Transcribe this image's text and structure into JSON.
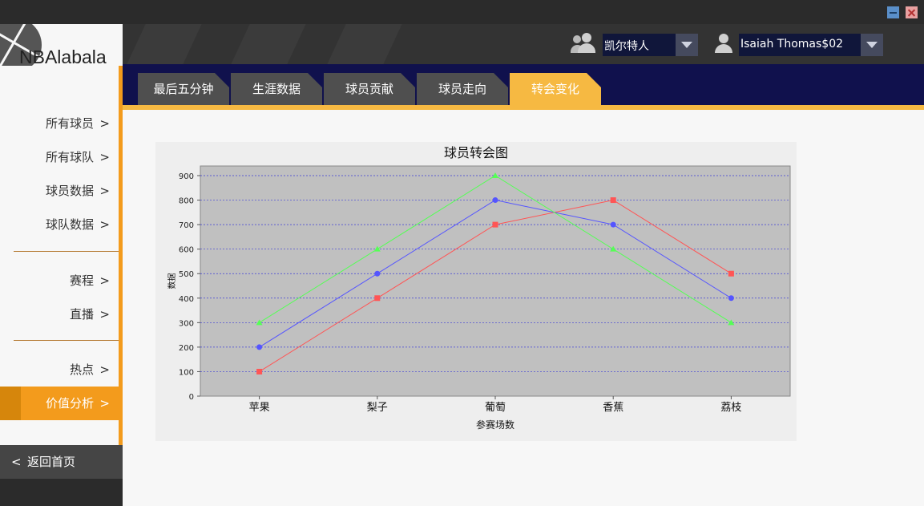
{
  "app": {
    "name": "NBAlabala"
  },
  "window": {
    "minimize_icon": "minimize-icon",
    "close_icon": "close-icon"
  },
  "header": {
    "team_select": {
      "value": "凯尔特人",
      "icon": "group-users-icon"
    },
    "player_select": {
      "value": "Isaiah Thomas$02",
      "icon": "user-icon"
    }
  },
  "tabs": [
    {
      "label": "最后五分钟",
      "active": false
    },
    {
      "label": "生涯数据",
      "active": false
    },
    {
      "label": "球员贡献",
      "active": false
    },
    {
      "label": "球员走向",
      "active": false
    },
    {
      "label": "转会变化",
      "active": true
    }
  ],
  "sidebar": {
    "items": [
      {
        "label": "所有球员",
        "chevron": ">"
      },
      {
        "label": "所有球队",
        "chevron": ">"
      },
      {
        "label": "球员数据",
        "chevron": ">"
      },
      {
        "label": "球队数据",
        "chevron": ">"
      },
      {
        "label": "赛程",
        "chevron": ">"
      },
      {
        "label": "直播",
        "chevron": ">"
      },
      {
        "label": "热点",
        "chevron": ">"
      },
      {
        "label": "价值分析",
        "chevron": ">",
        "active": true
      }
    ],
    "back": {
      "chevron": "<",
      "label": "返回首页"
    }
  },
  "colors": {
    "accent": "#f39b1c",
    "tab_active": "#f6b942",
    "tab_inactive": "#4f4f4f",
    "tabbar_bg": "#10114d",
    "plot_bg": "#c0c0c0"
  },
  "chart_data": {
    "type": "line",
    "title": "球员转会图",
    "xlabel": "参赛场数",
    "ylabel": "数据",
    "categories": [
      "苹果",
      "梨子",
      "葡萄",
      "香蕉",
      "荔枝"
    ],
    "ylim": [
      0,
      900
    ],
    "yticks": [
      0,
      100,
      200,
      300,
      400,
      500,
      600,
      700,
      800,
      900
    ],
    "grid": true,
    "series": [
      {
        "values": [
          100,
          400,
          700,
          800,
          500
        ],
        "color": "#ff5555",
        "marker": "square"
      },
      {
        "values": [
          200,
          500,
          800,
          700,
          400
        ],
        "color": "#5555ff",
        "marker": "circle"
      },
      {
        "values": [
          300,
          600,
          900,
          600,
          300
        ],
        "color": "#55ff55",
        "marker": "triangle"
      }
    ]
  }
}
